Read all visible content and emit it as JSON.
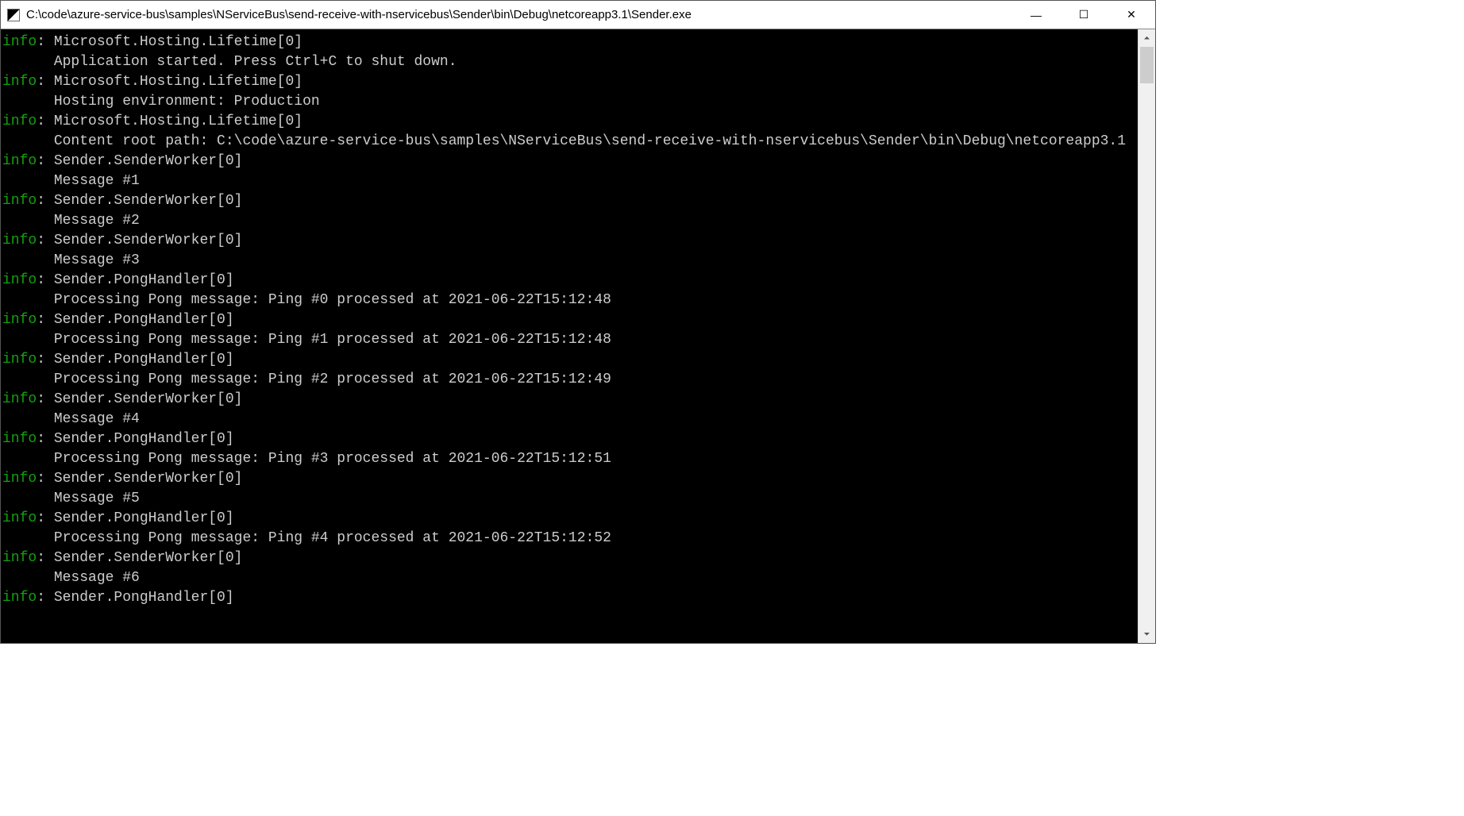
{
  "window": {
    "title": "C:\\code\\azure-service-bus\\samples\\NServiceBus\\send-receive-with-nservicebus\\Sender\\bin\\Debug\\netcoreapp3.1\\Sender.exe"
  },
  "controls": {
    "minimize": "—",
    "maximize": "☐",
    "close": "✕"
  },
  "scroll": {
    "up": "⏶",
    "down": "⏷"
  },
  "log": [
    {
      "level": "info",
      "source": "Microsoft.Hosting.Lifetime[0]",
      "body": "Application started. Press Ctrl+C to shut down."
    },
    {
      "level": "info",
      "source": "Microsoft.Hosting.Lifetime[0]",
      "body": "Hosting environment: Production"
    },
    {
      "level": "info",
      "source": "Microsoft.Hosting.Lifetime[0]",
      "body": "Content root path: C:\\code\\azure-service-bus\\samples\\NServiceBus\\send-receive-with-nservicebus\\Sender\\bin\\Debug\\netcoreapp3.1"
    },
    {
      "level": "info",
      "source": "Sender.SenderWorker[0]",
      "body": "Message #1"
    },
    {
      "level": "info",
      "source": "Sender.SenderWorker[0]",
      "body": "Message #2"
    },
    {
      "level": "info",
      "source": "Sender.SenderWorker[0]",
      "body": "Message #3"
    },
    {
      "level": "info",
      "source": "Sender.PongHandler[0]",
      "body": "Processing Pong message: Ping #0 processed at 2021-06-22T15:12:48"
    },
    {
      "level": "info",
      "source": "Sender.PongHandler[0]",
      "body": "Processing Pong message: Ping #1 processed at 2021-06-22T15:12:48"
    },
    {
      "level": "info",
      "source": "Sender.PongHandler[0]",
      "body": "Processing Pong message: Ping #2 processed at 2021-06-22T15:12:49"
    },
    {
      "level": "info",
      "source": "Sender.SenderWorker[0]",
      "body": "Message #4"
    },
    {
      "level": "info",
      "source": "Sender.PongHandler[0]",
      "body": "Processing Pong message: Ping #3 processed at 2021-06-22T15:12:51"
    },
    {
      "level": "info",
      "source": "Sender.SenderWorker[0]",
      "body": "Message #5"
    },
    {
      "level": "info",
      "source": "Sender.PongHandler[0]",
      "body": "Processing Pong message: Ping #4 processed at 2021-06-22T15:12:52"
    },
    {
      "level": "info",
      "source": "Sender.SenderWorker[0]",
      "body": "Message #6"
    },
    {
      "level": "info",
      "source": "Sender.PongHandler[0]",
      "body": ""
    }
  ]
}
